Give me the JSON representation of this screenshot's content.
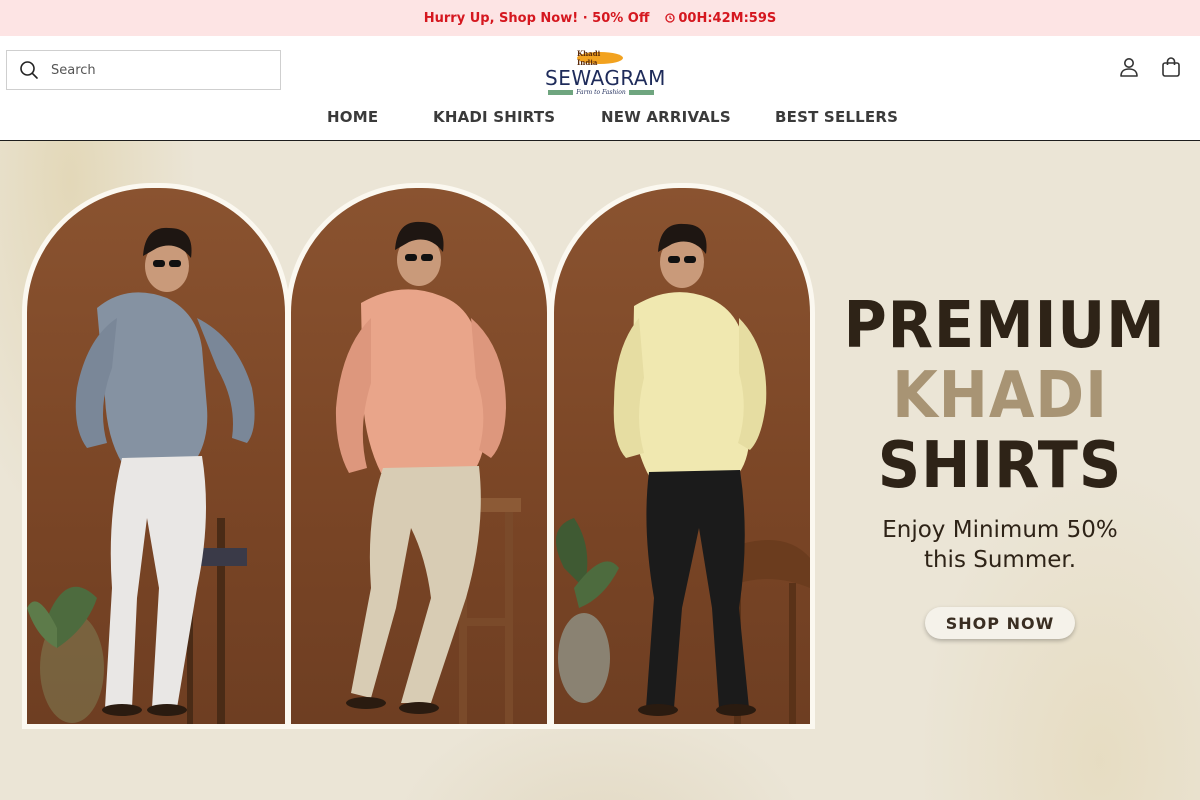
{
  "announcement": {
    "text": "Hurry Up, Shop Now! · 50% Off",
    "timer": "00H:42M:59S",
    "timer_icon": "clock-icon"
  },
  "header": {
    "search_placeholder": "Search",
    "logo": {
      "badge": "Khadi India",
      "name": "SEWAGRAM",
      "tagline": "Farm to Fashion"
    },
    "icons": [
      "account-icon",
      "cart-icon"
    ]
  },
  "nav": {
    "items": [
      {
        "label": "HOME"
      },
      {
        "label": "KHADI SHIRTS"
      },
      {
        "label": "NEW ARRIVALS"
      },
      {
        "label": "BEST SELLERS"
      }
    ]
  },
  "hero": {
    "headline_line1": "PREMIUM",
    "headline_line2": "KHADI",
    "headline_line3": "SHIRTS",
    "subline_1": "Enjoy Minimum 50%",
    "subline_2": "this Summer.",
    "cta": "SHOP NOW",
    "models": [
      {
        "shirt_color": "#8592a2",
        "pants_color": "#e9e7e5"
      },
      {
        "shirt_color": "#e9a58a",
        "pants_color": "#d8ccb4"
      },
      {
        "shirt_color": "#f0e8b0",
        "pants_color": "#1b1b1b"
      }
    ],
    "colors": {
      "headline_dark": "#2e2317",
      "headline_accent": "#a89474",
      "arch_background": "#7b4626"
    }
  }
}
